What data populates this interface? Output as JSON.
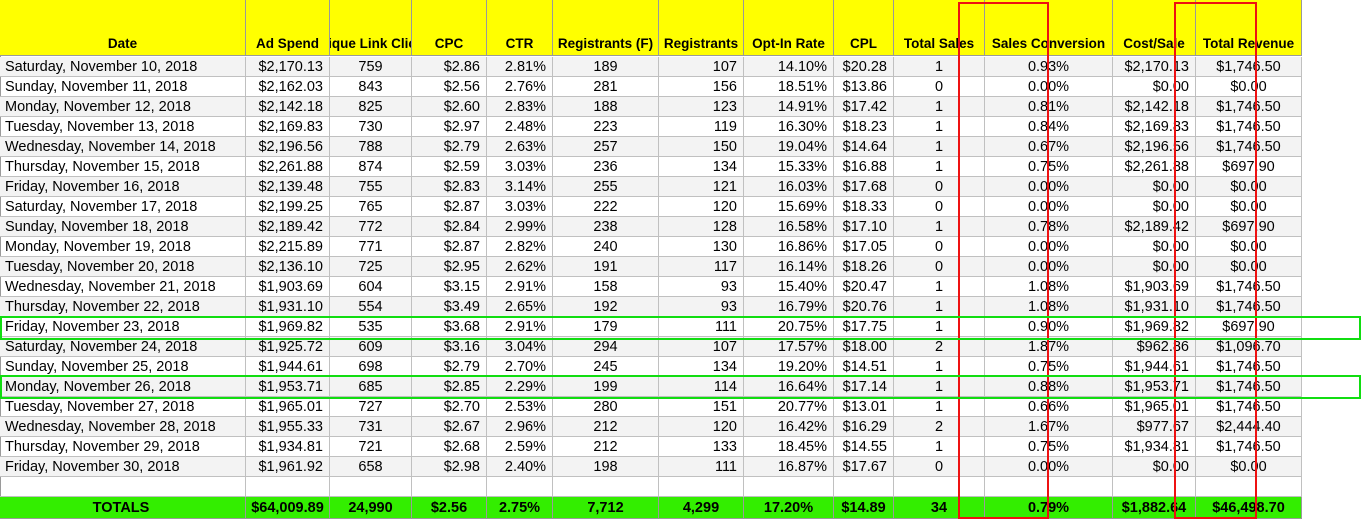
{
  "columns": [
    "Date",
    "Ad Spend",
    "Unique Link Clicks",
    "CPC",
    "CTR",
    "Registrants (F)",
    "Registrants",
    "Opt-In Rate",
    "CPL",
    "Total Sales",
    "Sales Conversion",
    "Cost/Sale",
    "Total Revenue"
  ],
  "rows": [
    [
      "Saturday, November 10, 2018",
      "$2,170.13",
      "759",
      "$2.86",
      "2.81%",
      "189",
      "107",
      "14.10%",
      "$20.28",
      "1",
      "0.93%",
      "$2,170.13",
      "$1,746.50"
    ],
    [
      "Sunday, November 11, 2018",
      "$2,162.03",
      "843",
      "$2.56",
      "2.76%",
      "281",
      "156",
      "18.51%",
      "$13.86",
      "0",
      "0.00%",
      "$0.00",
      "$0.00"
    ],
    [
      "Monday, November 12, 2018",
      "$2,142.18",
      "825",
      "$2.60",
      "2.83%",
      "188",
      "123",
      "14.91%",
      "$17.42",
      "1",
      "0.81%",
      "$2,142.18",
      "$1,746.50"
    ],
    [
      "Tuesday, November 13, 2018",
      "$2,169.83",
      "730",
      "$2.97",
      "2.48%",
      "223",
      "119",
      "16.30%",
      "$18.23",
      "1",
      "0.84%",
      "$2,169.83",
      "$1,746.50"
    ],
    [
      "Wednesday, November 14, 2018",
      "$2,196.56",
      "788",
      "$2.79",
      "2.63%",
      "257",
      "150",
      "19.04%",
      "$14.64",
      "1",
      "0.67%",
      "$2,196.56",
      "$1,746.50"
    ],
    [
      "Thursday, November 15, 2018",
      "$2,261.88",
      "874",
      "$2.59",
      "3.03%",
      "236",
      "134",
      "15.33%",
      "$16.88",
      "1",
      "0.75%",
      "$2,261.88",
      "$697.90"
    ],
    [
      "Friday, November 16, 2018",
      "$2,139.48",
      "755",
      "$2.83",
      "3.14%",
      "255",
      "121",
      "16.03%",
      "$17.68",
      "0",
      "0.00%",
      "$0.00",
      "$0.00"
    ],
    [
      "Saturday, November 17, 2018",
      "$2,199.25",
      "765",
      "$2.87",
      "3.03%",
      "222",
      "120",
      "15.69%",
      "$18.33",
      "0",
      "0.00%",
      "$0.00",
      "$0.00"
    ],
    [
      "Sunday, November 18, 2018",
      "$2,189.42",
      "772",
      "$2.84",
      "2.99%",
      "238",
      "128",
      "16.58%",
      "$17.10",
      "1",
      "0.78%",
      "$2,189.42",
      "$697.90"
    ],
    [
      "Monday, November 19, 2018",
      "$2,215.89",
      "771",
      "$2.87",
      "2.82%",
      "240",
      "130",
      "16.86%",
      "$17.05",
      "0",
      "0.00%",
      "$0.00",
      "$0.00"
    ],
    [
      "Tuesday, November 20, 2018",
      "$2,136.10",
      "725",
      "$2.95",
      "2.62%",
      "191",
      "117",
      "16.14%",
      "$18.26",
      "0",
      "0.00%",
      "$0.00",
      "$0.00"
    ],
    [
      "Wednesday, November 21, 2018",
      "$1,903.69",
      "604",
      "$3.15",
      "2.91%",
      "158",
      "93",
      "15.40%",
      "$20.47",
      "1",
      "1.08%",
      "$1,903.69",
      "$1,746.50"
    ],
    [
      "Thursday, November 22, 2018",
      "$1,931.10",
      "554",
      "$3.49",
      "2.65%",
      "192",
      "93",
      "16.79%",
      "$20.76",
      "1",
      "1.08%",
      "$1,931.10",
      "$1,746.50"
    ],
    [
      "Friday, November 23, 2018",
      "$1,969.82",
      "535",
      "$3.68",
      "2.91%",
      "179",
      "111",
      "20.75%",
      "$17.75",
      "1",
      "0.90%",
      "$1,969.82",
      "$697.90"
    ],
    [
      "Saturday, November 24, 2018",
      "$1,925.72",
      "609",
      "$3.16",
      "3.04%",
      "294",
      "107",
      "17.57%",
      "$18.00",
      "2",
      "1.87%",
      "$962.86",
      "$1,096.70"
    ],
    [
      "Sunday, November 25, 2018",
      "$1,944.61",
      "698",
      "$2.79",
      "2.70%",
      "245",
      "134",
      "19.20%",
      "$14.51",
      "1",
      "0.75%",
      "$1,944.61",
      "$1,746.50"
    ],
    [
      "Monday, November 26, 2018",
      "$1,953.71",
      "685",
      "$2.85",
      "2.29%",
      "199",
      "114",
      "16.64%",
      "$17.14",
      "1",
      "0.88%",
      "$1,953.71",
      "$1,746.50"
    ],
    [
      "Tuesday, November 27, 2018",
      "$1,965.01",
      "727",
      "$2.70",
      "2.53%",
      "280",
      "151",
      "20.77%",
      "$13.01",
      "1",
      "0.66%",
      "$1,965.01",
      "$1,746.50"
    ],
    [
      "Wednesday, November 28, 2018",
      "$1,955.33",
      "731",
      "$2.67",
      "2.96%",
      "212",
      "120",
      "16.42%",
      "$16.29",
      "2",
      "1.67%",
      "$977.67",
      "$2,444.40"
    ],
    [
      "Thursday, November 29, 2018",
      "$1,934.81",
      "721",
      "$2.68",
      "2.59%",
      "212",
      "133",
      "18.45%",
      "$14.55",
      "1",
      "0.75%",
      "$1,934.81",
      "$1,746.50"
    ],
    [
      "Friday, November 30, 2018",
      "$1,961.92",
      "658",
      "$2.98",
      "2.40%",
      "198",
      "111",
      "16.87%",
      "$17.67",
      "0",
      "0.00%",
      "$0.00",
      "$0.00"
    ]
  ],
  "totals": [
    "TOTALS",
    "$64,009.89",
    "24,990",
    "$2.56",
    "2.75%",
    "7,712",
    "4,299",
    "17.20%",
    "$14.89",
    "34",
    "0.79%",
    "$1,882.64",
    "$46,498.70"
  ],
  "highlight_colors": {
    "header": "#ffff00",
    "totals": "#33ee00",
    "red_box": "#ee1111",
    "green_box": "#11dd11"
  }
}
